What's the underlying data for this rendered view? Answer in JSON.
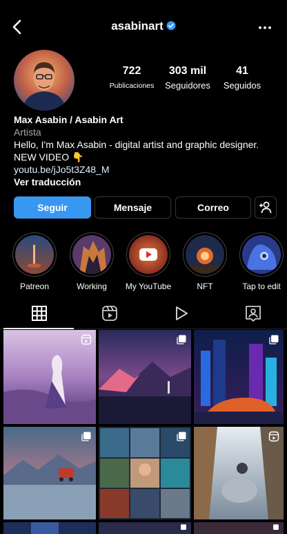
{
  "header": {
    "username": "asabinart",
    "icons": {
      "back": "chevron-left-icon",
      "verified": "verified-badge-icon",
      "more": "more-horizontal-icon"
    }
  },
  "stats": [
    {
      "value": "722",
      "label": "Publicaciones"
    },
    {
      "value": "303 mil",
      "label": "Seguidores"
    },
    {
      "value": "41",
      "label": "Seguidos"
    }
  ],
  "bio": {
    "name": "Max Asabin / Asabin Art",
    "category": "Artista",
    "line1": "Hello, I'm Max Asabin - digital artist and graphic designer.",
    "line2": "NEW VIDEO 👇",
    "link": "youtu.be/jJo5t3Z48_M",
    "translate": "Ver traducción"
  },
  "actions": {
    "follow": "Seguir",
    "message": "Mensaje",
    "email": "Correo",
    "add_person_icon": "add-person-icon"
  },
  "highlights": [
    {
      "label": "Patreon"
    },
    {
      "label": "Working"
    },
    {
      "label": "My YouTube"
    },
    {
      "label": "NFT"
    },
    {
      "label": "Tap to edit"
    }
  ],
  "tabs": [
    {
      "icon": "grid-icon",
      "active": true
    },
    {
      "icon": "reels-icon",
      "active": false
    },
    {
      "icon": "play-icon",
      "active": false
    },
    {
      "icon": "tagged-icon",
      "active": false
    }
  ],
  "colors": {
    "accent": "#3897f0",
    "background": "#000000",
    "muted": "#a8a8a8"
  }
}
